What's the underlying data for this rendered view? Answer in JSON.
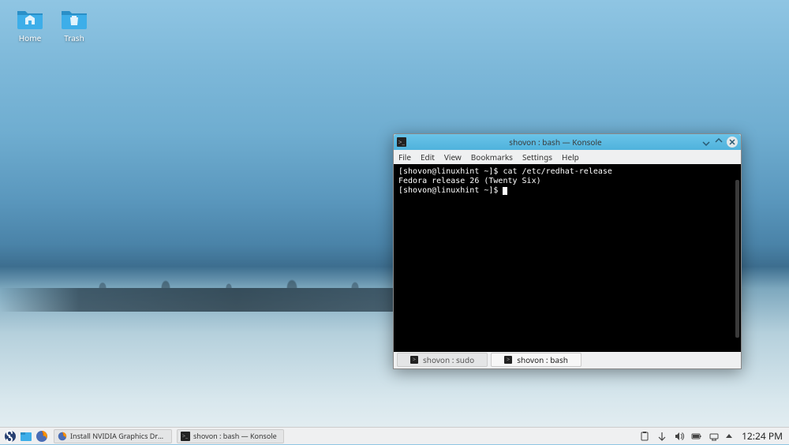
{
  "desktop": {
    "icons": {
      "home": "Home",
      "trash": "Trash"
    }
  },
  "terminal_window": {
    "title": "shovon : bash — Konsole",
    "menubar": [
      "File",
      "Edit",
      "View",
      "Bookmarks",
      "Settings",
      "Help"
    ],
    "lines": [
      "[shovon@linuxhint ~]$ cat /etc/redhat-release",
      "Fedora release 26 (Twenty Six)",
      "[shovon@linuxhint ~]$ "
    ],
    "tabs": [
      {
        "label": "shovon : sudo",
        "active": false
      },
      {
        "label": "shovon : bash",
        "active": true
      }
    ]
  },
  "taskbar": {
    "entries": [
      {
        "label": "Install NVIDIA Graphics Driv...",
        "icon": "firefox"
      },
      {
        "label": "shovon : bash — Konsole",
        "icon": "terminal"
      }
    ],
    "clock": "12:24 PM"
  }
}
